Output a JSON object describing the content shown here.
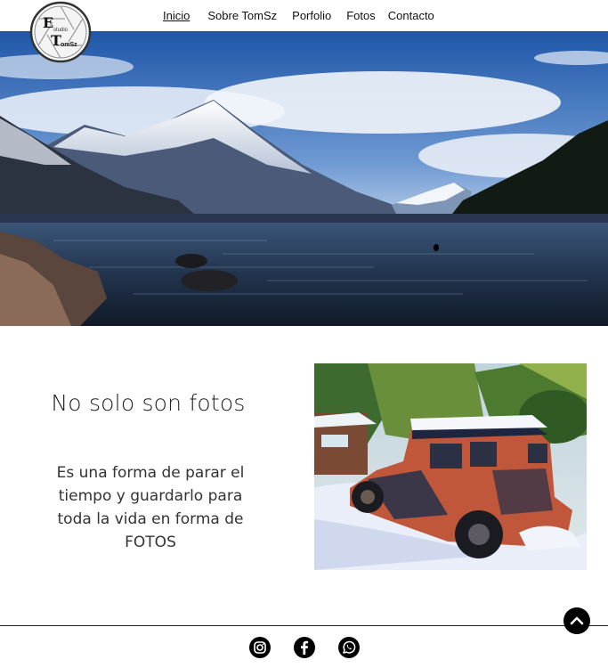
{
  "logo": {
    "line1": "E",
    "line2": "T",
    "small1": "studio",
    "small2": "omSz"
  },
  "nav": {
    "items": [
      {
        "label": "Inicio",
        "active": true
      },
      {
        "label": "Sobre TomSz",
        "active": false
      },
      {
        "label": "Porfolio",
        "active": false
      },
      {
        "label": "Fotos",
        "active": false
      },
      {
        "label": "Contacto",
        "active": false
      }
    ]
  },
  "main": {
    "title": "No solo son fotos",
    "text": "Es una forma de parar el tiempo y guardarlo para toda la vida en forma de FOTOS"
  },
  "footer": {
    "social": [
      "instagram-icon",
      "facebook-icon",
      "whatsapp-icon"
    ]
  },
  "colors": {
    "icon": "#000000",
    "line": "#222222"
  }
}
